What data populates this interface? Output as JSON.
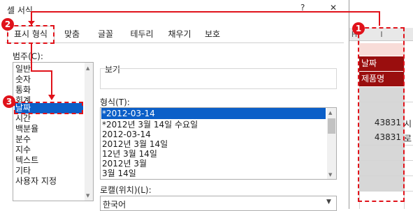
{
  "dialog": {
    "title": "셀 서식",
    "help": "?",
    "close": "✕",
    "tabs": [
      "표시 형식",
      "맞춤",
      "글꼴",
      "테두리",
      "채우기",
      "보호"
    ],
    "category_label": "범주(C):",
    "categories": [
      "일반",
      "숫자",
      "통화",
      "회계",
      "날짜",
      "시간",
      "백분율",
      "분수",
      "지수",
      "텍스트",
      "기타",
      "사용자 지정"
    ],
    "selected_category": "날짜",
    "sample_label": "보기",
    "format_label": "형식(T):",
    "formats": [
      "*2012-03-14",
      "*2012년 3월 14일 수요일",
      "2012-03-14",
      "2012년 3월 14일",
      "12년 3월 14일",
      "2012년 3월",
      "3월 14일"
    ],
    "selected_format": "*2012-03-14",
    "locale_label": "로캘(위치)(L):",
    "locale_value": "한국어"
  },
  "sheet": {
    "col_h": "H",
    "col_i": "I",
    "cells": [
      "날짜",
      "제품명",
      "43831",
      "43831"
    ],
    "overflow": [
      "시",
      "로"
    ]
  },
  "annotations": {
    "step1": "1",
    "step2": "2",
    "step3": "3"
  },
  "colors": {
    "annotation": "#e0121a",
    "selection": "#0b5fc8",
    "header_fill": "#9a0e0e"
  }
}
